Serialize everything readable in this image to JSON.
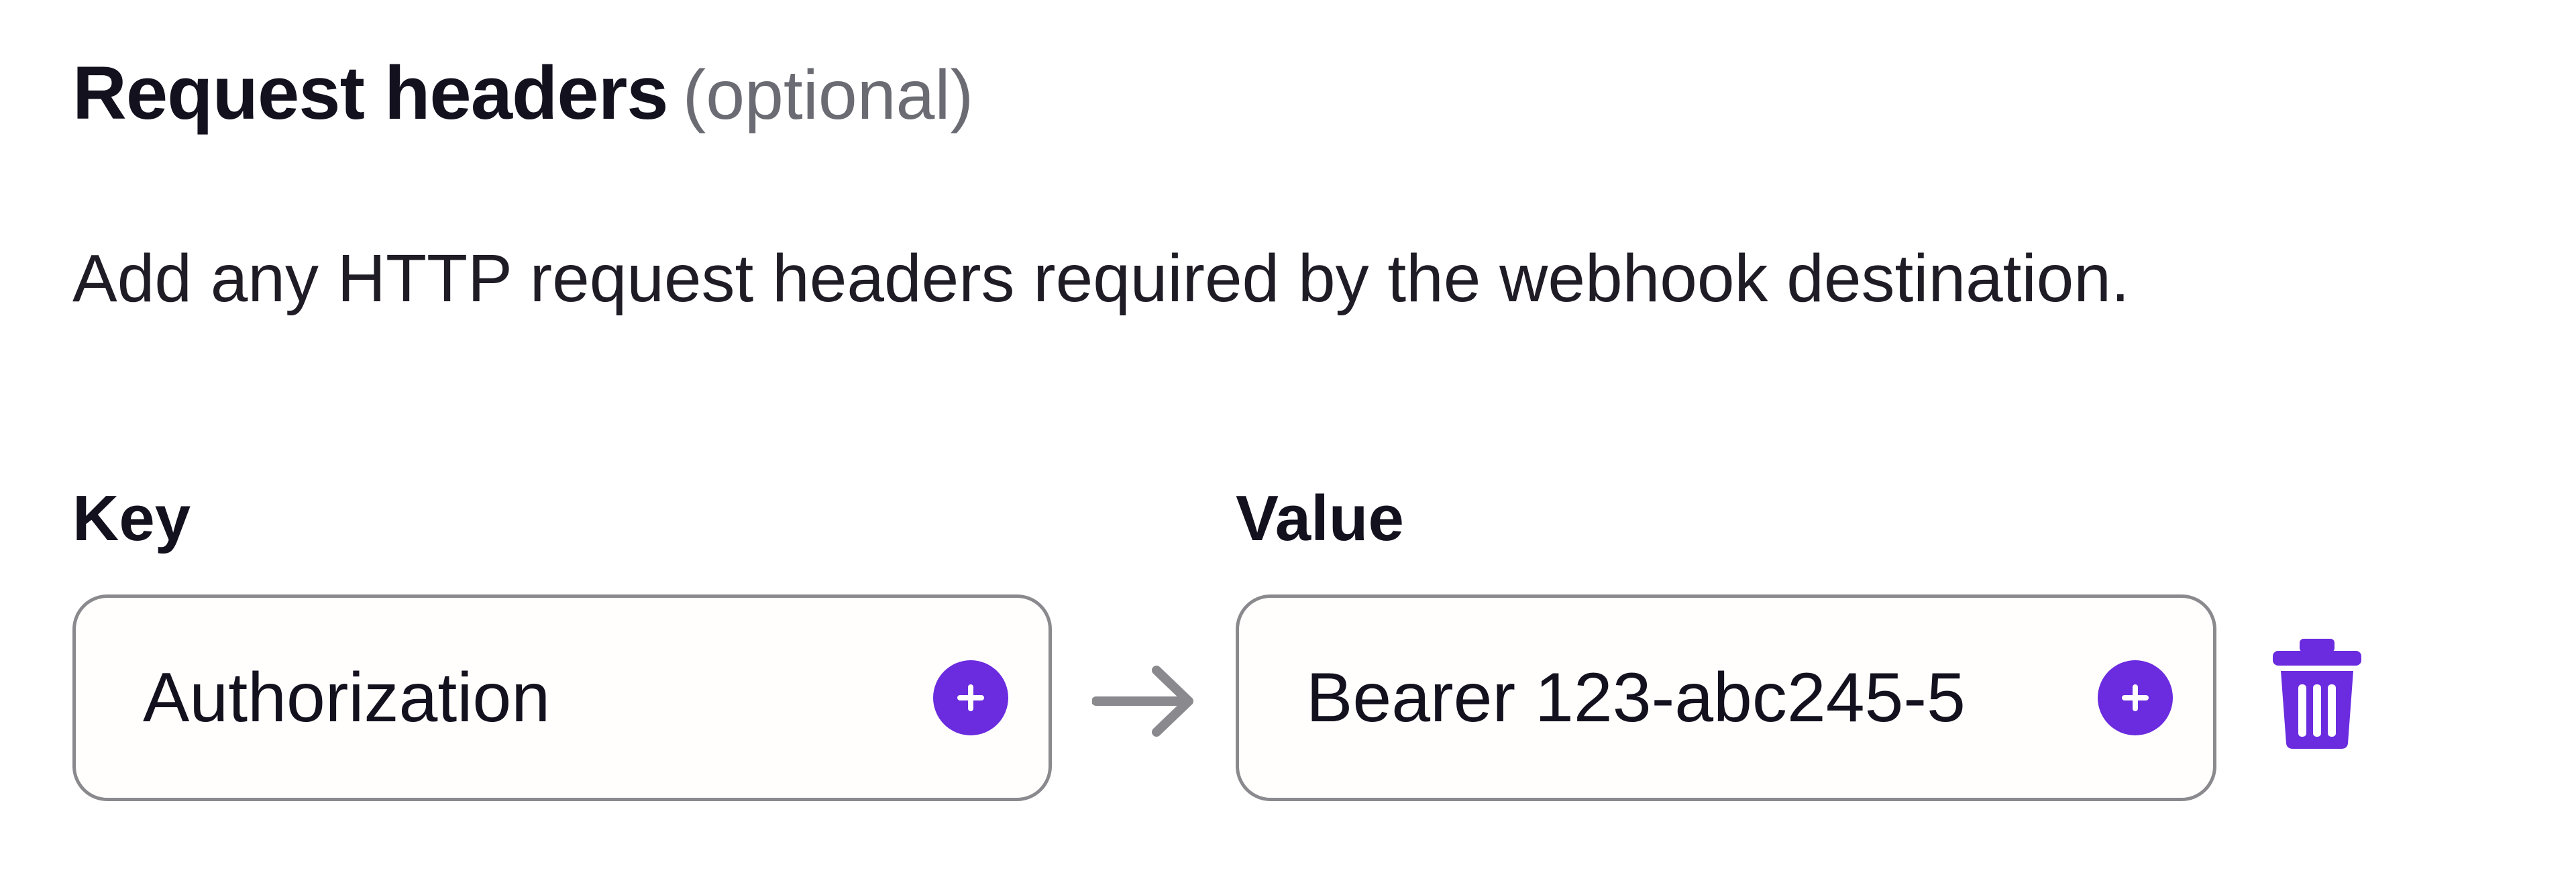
{
  "section": {
    "title": "Request headers",
    "optional_label": "(optional)",
    "description": "Add any HTTP request headers required by the webhook destination."
  },
  "fields": {
    "key_label": "Key",
    "value_label": "Value"
  },
  "header_row": {
    "key_value": "Authorization",
    "value_value": "Bearer 123-abc245-5"
  },
  "icons": {
    "add": "plus-circle-icon",
    "arrow": "arrow-right-icon",
    "delete": "trash-icon"
  },
  "colors": {
    "accent": "#6b2bdf",
    "border": "#8a8a8e",
    "arrow": "#8a8a8e",
    "text": "#14111f",
    "muted": "#6b6b73"
  }
}
